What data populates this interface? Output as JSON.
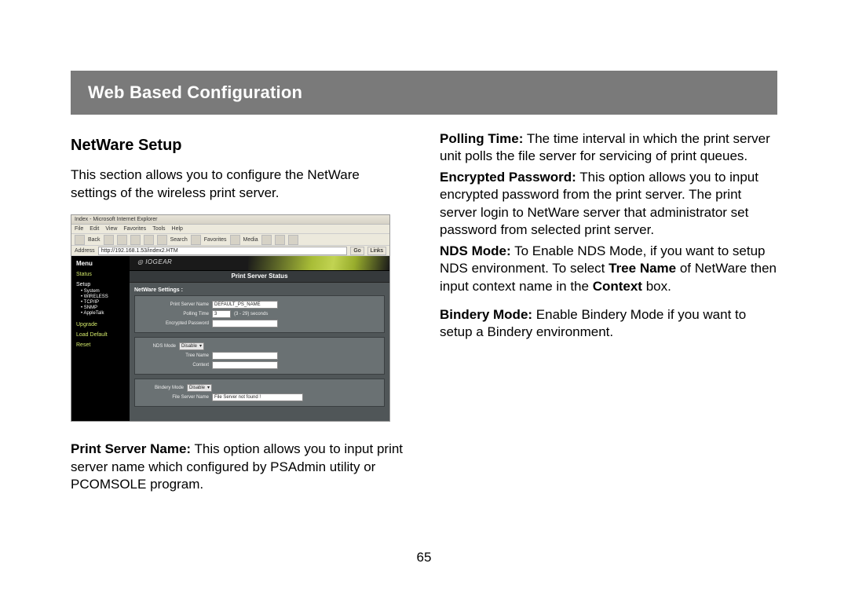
{
  "header": {
    "title": "Web Based Configuration"
  },
  "left": {
    "section_title": "NetWare Setup",
    "intro": "This section allows you to configure the NetWare settings of the wireless print server.",
    "psn_label": "Print Server Name:",
    "psn_text": " This option allows you to input print server name which configured by PSAdmin utility or PCOMSOLE program."
  },
  "right": {
    "polling_label": "Polling Time:",
    "polling_text": " The time interval in which the print server unit polls the file server for servicing of print queues.",
    "enc_label": "Encrypted Password:",
    "enc_text": " This option allows you to input encrypted password from the print server. The print server login to NetWare server that administrator set password from selected print server.",
    "nds_label": "NDS Mode:",
    "nds_text_1": " To Enable NDS Mode, if you want to setup NDS environment. To select ",
    "nds_text_bold1": "Tree Name",
    "nds_text_2": " of NetWare then input context name in the ",
    "nds_text_bold2": "Context",
    "nds_text_3": " box.",
    "bindery_label": "Bindery Mode:",
    "bindery_text": " Enable Bindery Mode if you want to setup a Bindery environment."
  },
  "screenshot": {
    "titlebar": "Index - Microsoft Internet Explorer",
    "menubar": [
      "File",
      "Edit",
      "View",
      "Favorites",
      "Tools",
      "Help"
    ],
    "toolbar_back": "Back",
    "toolbar_search": "Search",
    "toolbar_favorites": "Favorites",
    "toolbar_media": "Media",
    "address_label": "Address",
    "address_value": "http://192.168.1.53/index2.HTM",
    "go": "Go",
    "links": "Links",
    "sidebar": {
      "title": "Menu",
      "status": "Status",
      "setup": "Setup",
      "subs": [
        "System",
        "WIRELESS",
        "TCP/IP",
        "SNMP",
        "AppleTalk"
      ],
      "upgrade": "Upgrade",
      "load_default": "Load Default",
      "reset": "Reset"
    },
    "brand": "IOGEAR",
    "status_heading": "Print Server Status",
    "nw_settings": "NetWare Settings :",
    "fields": {
      "psn_label": "Print Server Name",
      "psn_value": "DEFAULT_PS_NAME",
      "polling_label": "Polling Time",
      "polling_value": "3",
      "polling_hint": "(3 - 29) seconds",
      "encpw_label": "Encrypted Password",
      "nds_mode_label": "NDS Mode",
      "nds_mode_value": "Disable",
      "tree_label": "Tree Name",
      "context_label": "Context",
      "bindery_mode_label": "Bindery Mode",
      "bindery_mode_value": "Disable",
      "fs_label": "File Server Name",
      "fs_value": "File Server not found !"
    }
  },
  "page_number": "65"
}
